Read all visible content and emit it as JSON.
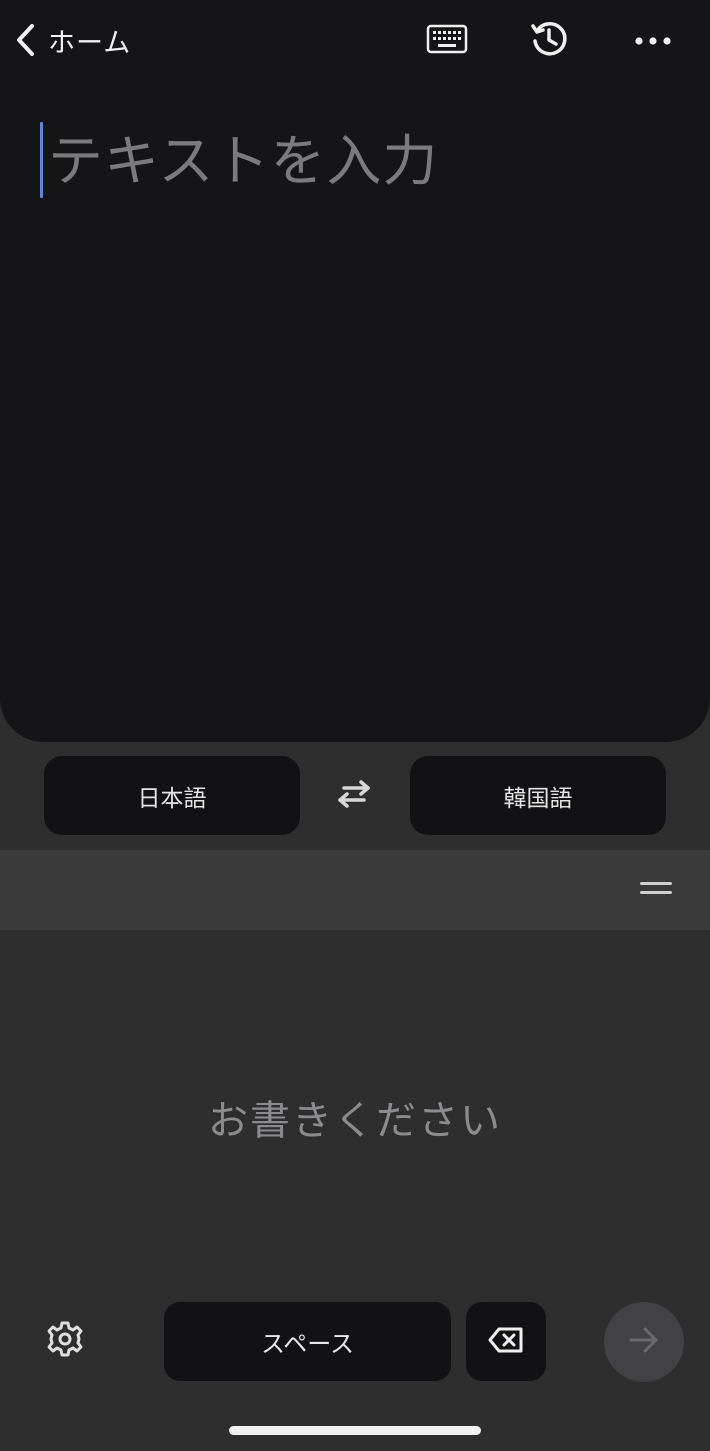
{
  "header": {
    "back_label": "ホーム"
  },
  "input": {
    "placeholder": "テキストを入力"
  },
  "languages": {
    "source": "日本語",
    "target": "韓国語"
  },
  "handwriting": {
    "hint": "お書きください"
  },
  "keyboard": {
    "space_label": "スペース"
  },
  "icons": {
    "back": "chevron-left-icon",
    "keyboard": "keyboard-icon",
    "history": "history-icon",
    "more": "more-horizontal-icon",
    "swap": "swap-arrows-icon",
    "drag": "drag-handle-icon",
    "settings": "gear-icon",
    "backspace": "backspace-icon",
    "enter": "arrow-right-icon"
  },
  "colors": {
    "panel_bg": "#151517",
    "app_bg": "#2e2e2f",
    "caret": "#5f86d8",
    "button_bg": "#121214"
  }
}
